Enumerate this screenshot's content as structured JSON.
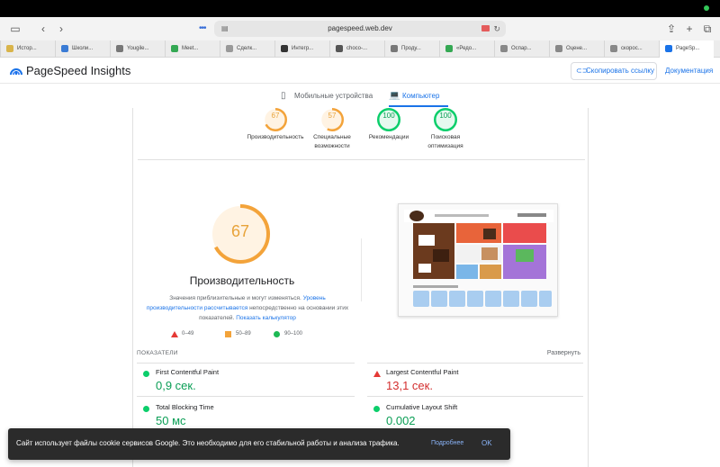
{
  "browser": {
    "url": "pagespeed.web.dev",
    "tabs": [
      {
        "label": "Истор...",
        "color": "#d9b44a"
      },
      {
        "label": "Школи...",
        "color": "#3a7bd5"
      },
      {
        "label": "Yougile...",
        "color": "#777"
      },
      {
        "label": "Meet...",
        "color": "#34a853"
      },
      {
        "label": "Сделк...",
        "color": "#999"
      },
      {
        "label": "Интегр...",
        "color": "#333"
      },
      {
        "label": "choco-...",
        "color": "#555"
      },
      {
        "label": "Проду...",
        "color": "#777"
      },
      {
        "label": "«Редо...",
        "color": "#34a853"
      },
      {
        "label": "Оспар...",
        "color": "#888"
      },
      {
        "label": "Оцене...",
        "color": "#888"
      },
      {
        "label": "скорос...",
        "color": "#888"
      },
      {
        "label": "PageSp...",
        "color": "#1a73e8"
      }
    ]
  },
  "header": {
    "title": "PageSpeed Insights",
    "copy_link": "Скопировать ссылку",
    "docs": "Документация"
  },
  "device_tabs": {
    "mobile": "Мобильные устройства",
    "desktop": "Компьютер"
  },
  "categories": [
    {
      "score": "67",
      "label": "Производительность",
      "color": "#f3a33a",
      "fraction": 0.67
    },
    {
      "score": "57",
      "label": "Специальные возможности",
      "color": "#f3a33a",
      "fraction": 0.57
    },
    {
      "score": "100",
      "label": "Рекомендации",
      "color": "#0cce6b",
      "fraction": 1.0
    },
    {
      "score": "100",
      "label": "Поисковая оптимизация",
      "color": "#0cce6b",
      "fraction": 1.0
    }
  ],
  "performance": {
    "score": "67",
    "fraction": 0.67,
    "title": "Производительность",
    "desc_1": "Значения приблизительные и могут изменяться.",
    "link_1": "Уровень производительности рассчитывается",
    "desc_2": "непосредственно на основании этих показателей.",
    "link_2": "Показать калькулятор"
  },
  "legend": {
    "bad": "0–49",
    "average": "50–89",
    "good": "90–100"
  },
  "metrics": {
    "label": "ПОКАЗАТЕЛИ",
    "expand": "Развернуть",
    "fcp": {
      "name": "First Contentful Paint",
      "value": "0,9 сек.",
      "status": "good"
    },
    "lcp": {
      "name": "Largest Contentful Paint",
      "value": "13,1 сек.",
      "status": "bad"
    },
    "tbt": {
      "name": "Total Blocking Time",
      "value": "50 мс",
      "status": "good"
    },
    "cls": {
      "name": "Cumulative Layout Shift",
      "value": "0.002",
      "status": "good"
    }
  },
  "cookie": {
    "text": "Сайт использует файлы cookie сервисов Google. Это необходимо для его стабильной работы и анализа трафика.",
    "more": "Подробнее",
    "ok": "OK"
  },
  "colors": {
    "good": "#0cce6b",
    "average": "#f3a33a",
    "bad": "#e53935",
    "accent": "#1a73e8"
  }
}
